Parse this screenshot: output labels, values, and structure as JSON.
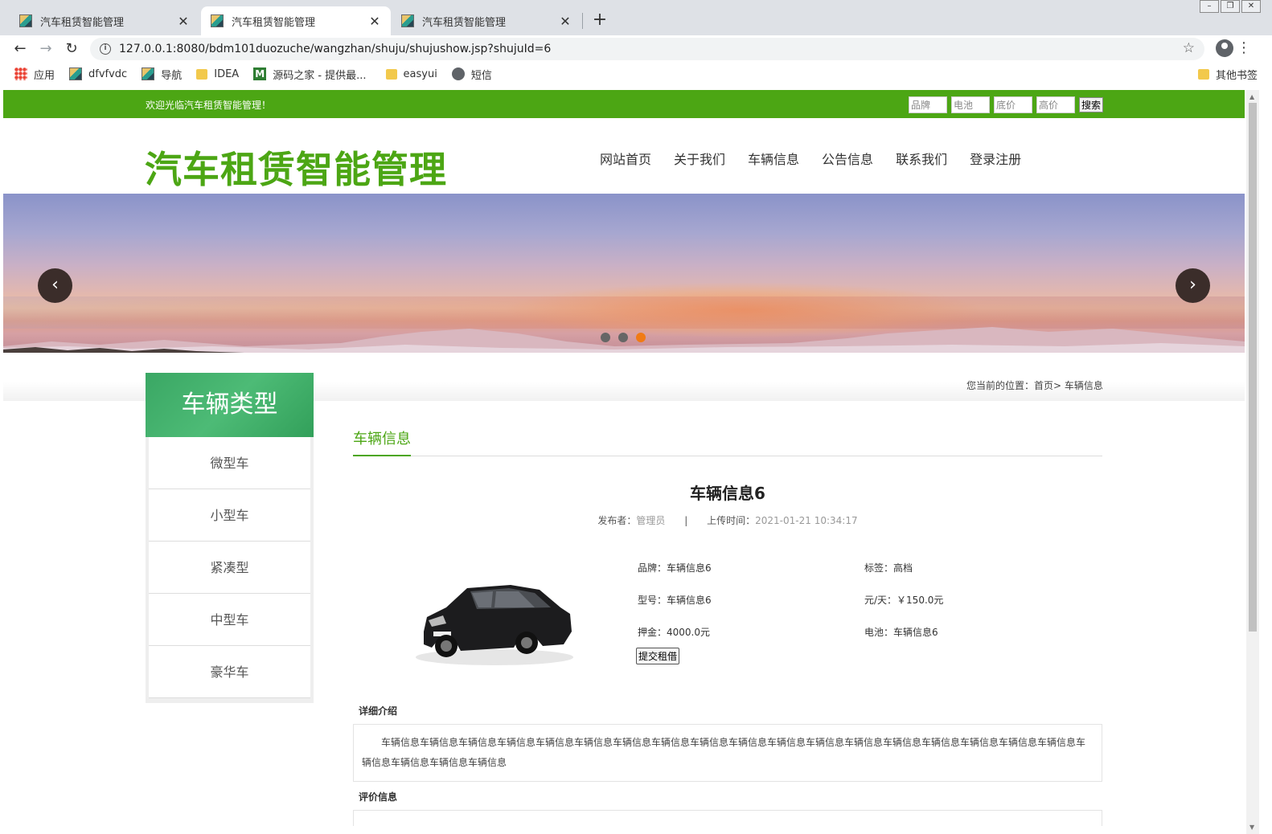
{
  "browser": {
    "tabs": [
      {
        "title": "汽车租赁智能管理",
        "active": false
      },
      {
        "title": "汽车租赁智能管理",
        "active": true
      },
      {
        "title": "汽车租赁智能管理",
        "active": false
      }
    ],
    "url": "127.0.0.1:8080/bdm101duozuche/wangzhan/shuju/shujushow.jsp?shujuId=6",
    "bookmarks": [
      "应用",
      "dfvfvdc",
      "导航",
      "IDEA",
      "源码之家 - 提供最...",
      "easyui",
      "短信"
    ],
    "other_bookmarks": "其他书签"
  },
  "site": {
    "welcome": "欢迎光临汽车租赁智能管理！",
    "search": {
      "brand_placeholder": "品牌",
      "battery_placeholder": "电池",
      "low_price_placeholder": "底价",
      "high_price_placeholder": "高价",
      "button": "搜索"
    },
    "logo": "汽车租赁智能管理",
    "nav": [
      "网站首页",
      "关于我们",
      "车辆信息",
      "公告信息",
      "联系我们",
      "登录注册"
    ],
    "banner": {
      "slide_count": 3,
      "active_slide": 3
    },
    "breadcrumb": {
      "prefix": "您当前的位置：",
      "home": "首页",
      "sep": ">",
      "current": "车辆信息"
    }
  },
  "sidebar": {
    "title": "车辆类型",
    "items": [
      "微型车",
      "小型车",
      "紧凑型",
      "中型车",
      "豪华车"
    ]
  },
  "content": {
    "section_tab": "车辆信息",
    "title": "车辆信息6",
    "publisher_label": "发布者：",
    "publisher": "管理员",
    "pipe": "|",
    "upload_label": "上传时间：",
    "upload_time": "2021-01-21 10:34:17",
    "fields": {
      "brand": "品牌：车辆信息6",
      "tag": "标签：高档",
      "model": "型号：车辆信息6",
      "price": "元/天：￥150.0元",
      "deposit": "押金：4000.0元",
      "battery": "电池：车辆信息6"
    },
    "rent_button": "提交租借",
    "intro_heading": "详细介绍",
    "intro_text": "车辆信息车辆信息车辆信息车辆信息车辆信息车辆信息车辆信息车辆信息车辆信息车辆信息车辆信息车辆信息车辆信息车辆信息车辆信息车辆信息车辆信息车辆信息车辆信息车辆信息车辆信息车辆信息",
    "review_heading": "评价信息"
  },
  "colors": {
    "brand_green": "#4ca614",
    "sidebar_green": "#3aa764",
    "active_dot": "#f07b15"
  }
}
